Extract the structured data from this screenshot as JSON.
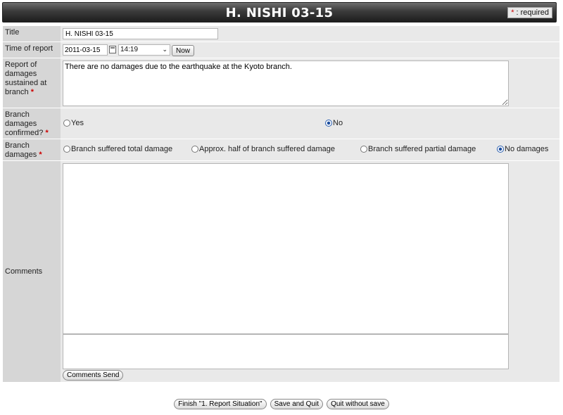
{
  "header": {
    "title": "H. NISHI 03-15",
    "required_star": "*",
    "required_text": " : required"
  },
  "fields": {
    "title": {
      "label": "Title",
      "value": "H. NISHI 03-15"
    },
    "time_of_report": {
      "label": "Time of report",
      "date": "2011-03-15",
      "time": "14:19",
      "now_button": "Now"
    },
    "report_damages": {
      "label": "Report of damages sustained at branch",
      "value": "There are no damages due to the earthquake at the Kyoto branch."
    },
    "damages_confirmed": {
      "label": "Branch damages confirmed?",
      "options": [
        "Yes",
        "No"
      ],
      "selected": "No"
    },
    "branch_damages": {
      "label": "Branch damages",
      "options": [
        "Branch suffered total damage",
        "Approx. half of branch suffered damage",
        "Branch suffered partial damage",
        "No damages"
      ],
      "selected": "No damages"
    },
    "comments": {
      "label": "Comments",
      "value": "",
      "input_value": "",
      "send_button": "Comments Send"
    }
  },
  "footer": {
    "finish_button": "Finish \"1. Report Situation\"",
    "save_quit_button": "Save and Quit",
    "quit_button": "Quit without save"
  },
  "required_star": "*"
}
